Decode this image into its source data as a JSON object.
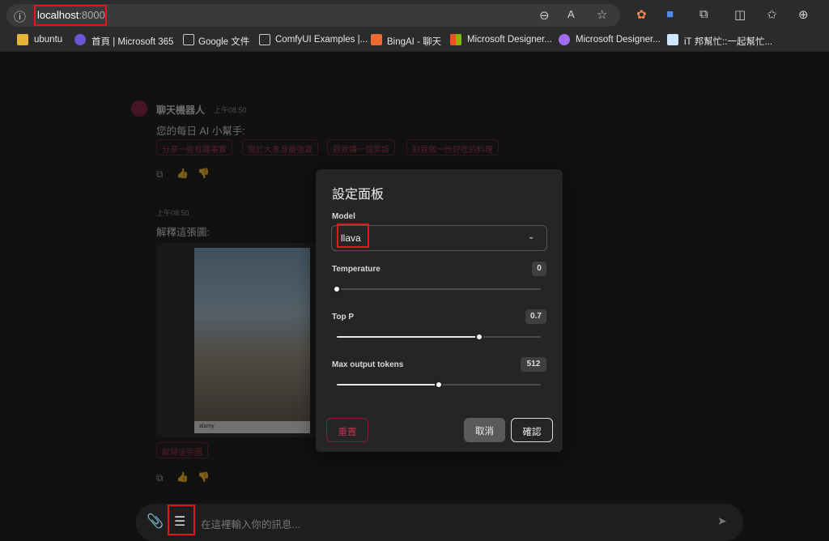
{
  "browser": {
    "url_host": "localhost",
    "url_port": ":8000",
    "bookmarks": [
      {
        "label": "ubuntu"
      },
      {
        "label": "首頁 | Microsoft 365"
      },
      {
        "label": "Google 文件"
      },
      {
        "label": "ComfyUI Examples |..."
      },
      {
        "label": "BingAI - 聊天"
      },
      {
        "label": "Microsoft Designer..."
      },
      {
        "label": "Microsoft Designer..."
      },
      {
        "label": "iT 邦幫忙::一起幫忙..."
      }
    ]
  },
  "chat": {
    "bot_name": "聊天機器人",
    "bot_time": "上午08:50",
    "bot_message": "您的每日 AI 小幫手:",
    "suggestions": [
      "分享一些有趣事實",
      "關於大象身最強寶",
      "跟我講一個笑話",
      "對我做一份好吃的料理"
    ],
    "user_time": "上午08:50",
    "user_message": "解釋這張圖:",
    "user_chip": "解釋這張圖",
    "photo_caption": "alamy",
    "input_placeholder": "在這裡輸入你的訊息..."
  },
  "modal": {
    "title": "設定面板",
    "model_label": "Model",
    "model_value": "llava",
    "temperature_label": "Temperature",
    "temperature_value": "0",
    "temperature_fraction": 0,
    "top_p_label": "Top P",
    "top_p_value": "0.7",
    "top_p_fraction": 0.7,
    "max_tokens_label": "Max output tokens",
    "max_tokens_value": "512",
    "max_tokens_fraction": 0.5,
    "reset_label": "重置",
    "cancel_label": "取消",
    "confirm_label": "確認"
  },
  "colors": {
    "accent": "#8a1c3b",
    "highlight": "#e3161d"
  }
}
